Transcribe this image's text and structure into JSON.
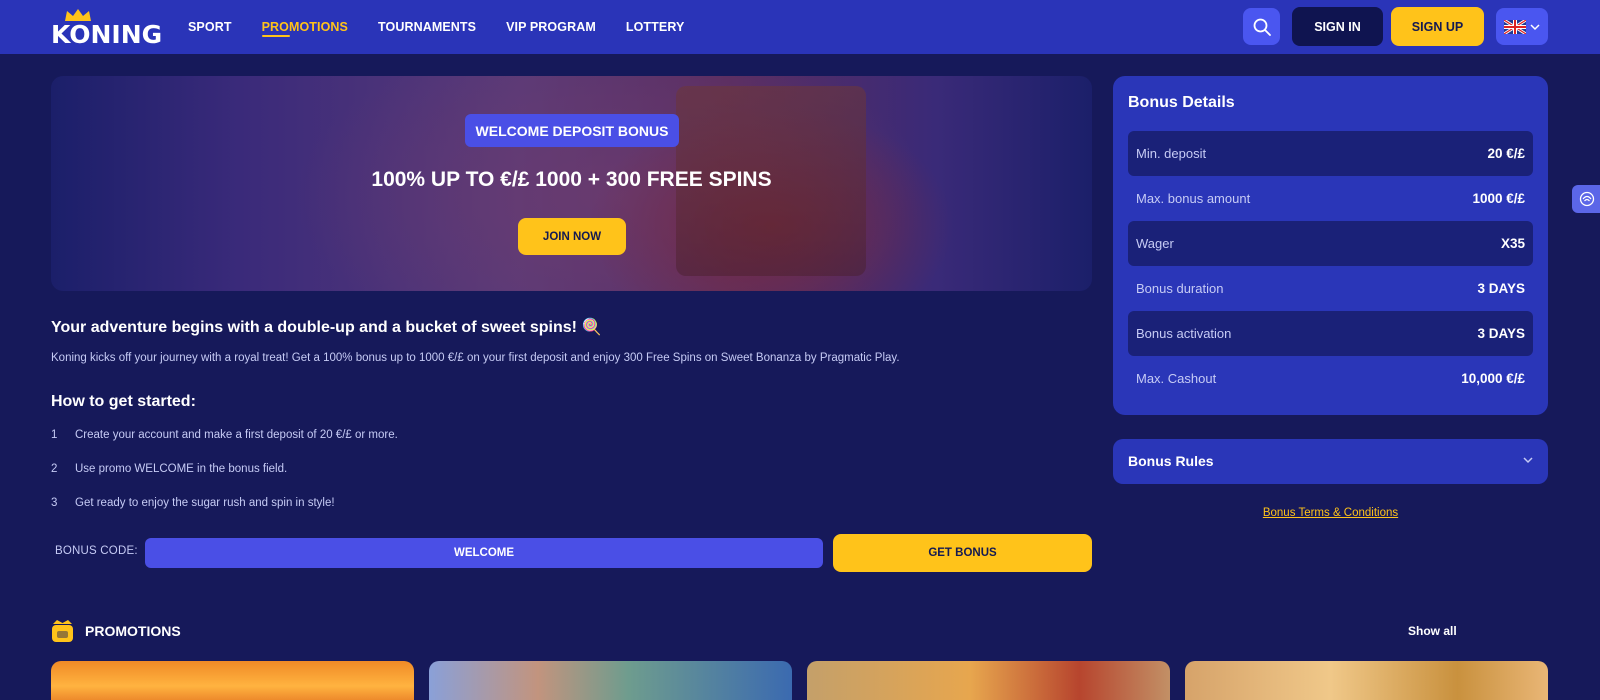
{
  "header": {
    "logo_text": "KONING",
    "nav": [
      {
        "label": "SPORT",
        "active": false
      },
      {
        "label": "PROMOTIONS",
        "active": true
      },
      {
        "label": "TOURNAMENTS",
        "active": false
      },
      {
        "label": "VIP PROGRAM",
        "active": false
      },
      {
        "label": "LOTTERY",
        "active": false
      }
    ],
    "sign_in": "SIGN IN",
    "sign_up": "SIGN UP",
    "search_icon": "search-icon",
    "language_flag": "uk-flag-icon"
  },
  "hero": {
    "badge": "WELCOME DEPOSIT BONUS",
    "title": "100% UP TO €/£ 1000 + 300 FREE SPINS",
    "cta": "JOIN NOW"
  },
  "content": {
    "intro_heading": "Your adventure begins with a double-up and a bucket of sweet spins! 🍭",
    "intro_text": "Koning kicks off your journey with a royal treat! Get a 100% bonus up to 1000 €/£ on your first deposit and enjoy 300 Free Spins on Sweet Bonanza by Pragmatic Play.",
    "howto_heading": "How to get started:",
    "steps": [
      {
        "num": "1",
        "text": "Create your account and make a first deposit of 20 €/£ or more."
      },
      {
        "num": "2",
        "text": "Use promo WELCOME in the bonus field."
      },
      {
        "num": "3",
        "text": "Get ready to enjoy the sugar rush and spin in style!"
      }
    ],
    "bonus_code_label": "BONUS CODE:",
    "bonus_code_value": "WELCOME",
    "get_bonus": "GET BONUS"
  },
  "bonus_details": {
    "title": "Bonus Details",
    "rows": [
      {
        "label": "Min. deposit",
        "value": "20 €/£"
      },
      {
        "label": "Max. bonus amount",
        "value": "1000 €/£"
      },
      {
        "label": "Wager",
        "value": "X35"
      },
      {
        "label": "Bonus duration",
        "value": "3 DAYS"
      },
      {
        "label": "Bonus activation",
        "value": "3 DAYS"
      },
      {
        "label": "Max. Cashout",
        "value": "10,000 €/£"
      }
    ]
  },
  "bonus_rules": {
    "title": "Bonus Rules"
  },
  "terms_link": "Bonus Terms & Conditions",
  "promotions": {
    "heading": "PROMOTIONS",
    "show_all": "Show all"
  },
  "colors": {
    "background": "#16195a",
    "header": "#2a34b8",
    "accent_yellow": "#ffc31a",
    "accent_blue": "#4a4fe6",
    "panel": "#2a36b8"
  }
}
